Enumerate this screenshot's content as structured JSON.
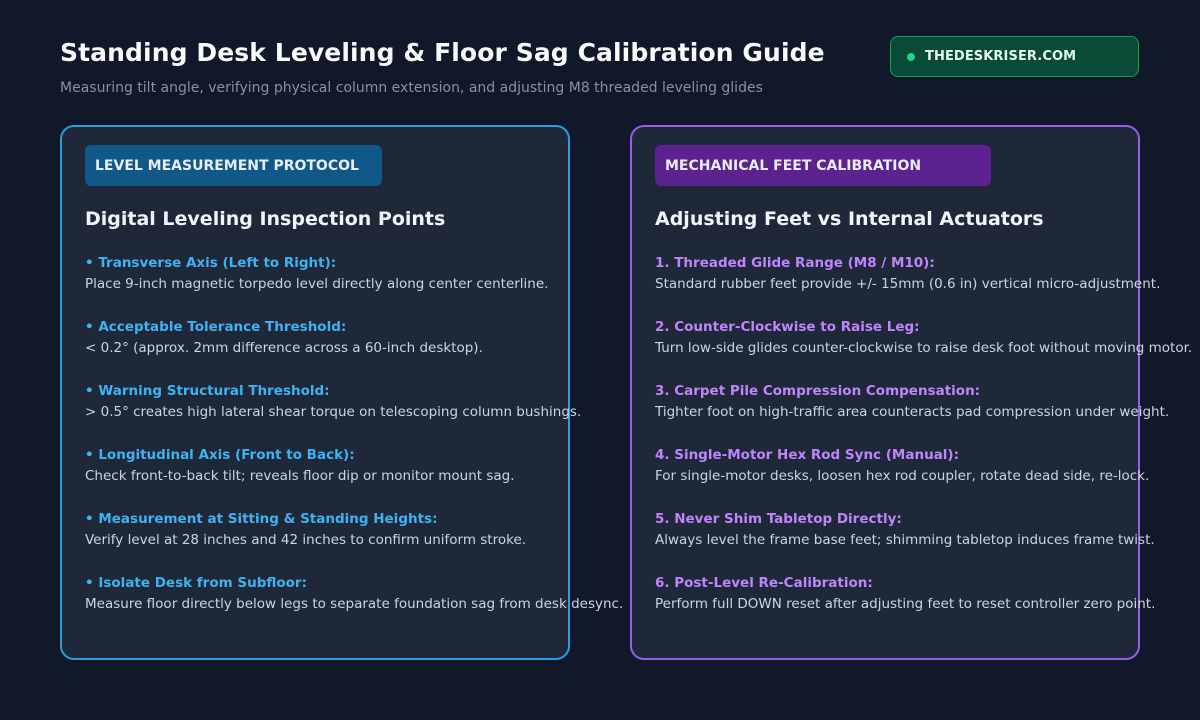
{
  "header": {
    "title": "Standing Desk Leveling & Floor Sag Calibration Guide",
    "subtitle": "Measuring tilt angle, verifying physical column extension, and adjusting M8 threaded leveling glides"
  },
  "brand": {
    "label": "THEDESKRISER.COM"
  },
  "left_card": {
    "tag": "LEVEL MEASUREMENT PROTOCOL",
    "title": "Digital Leveling Inspection Points",
    "items": [
      {
        "head": "• Transverse Axis (Left to Right):",
        "body": "Place 9-inch magnetic torpedo level directly along center centerline."
      },
      {
        "head": "• Acceptable Tolerance Threshold:",
        "body": "< 0.2° (approx. 2mm difference across a 60-inch desktop)."
      },
      {
        "head": "• Warning Structural Threshold:",
        "body": "> 0.5° creates high lateral shear torque on telescoping column bushings."
      },
      {
        "head": "• Longitudinal Axis (Front to Back):",
        "body": "Check front-to-back tilt; reveals floor dip or monitor mount sag."
      },
      {
        "head": "• Measurement at Sitting & Standing Heights:",
        "body": "Verify level at 28 inches and 42 inches to confirm uniform stroke."
      },
      {
        "head": "• Isolate Desk from Subfloor:",
        "body": "Measure floor directly below legs to separate foundation sag from desk desync."
      }
    ]
  },
  "right_card": {
    "tag": "MECHANICAL FEET CALIBRATION",
    "title": "Adjusting Feet vs Internal Actuators",
    "items": [
      {
        "head": "1. Threaded Glide Range (M8 / M10):",
        "body": "Standard rubber feet provide +/- 15mm (0.6 in) vertical micro-adjustment."
      },
      {
        "head": "2. Counter-Clockwise to Raise Leg:",
        "body": "Turn low-side glides counter-clockwise to raise desk foot without moving motor."
      },
      {
        "head": "3. Carpet Pile Compression Compensation:",
        "body": "Tighter foot on high-traffic area counteracts pad compression under weight."
      },
      {
        "head": "4. Single-Motor Hex Rod Sync (Manual):",
        "body": "For single-motor desks, loosen hex rod coupler, rotate dead side, re-lock."
      },
      {
        "head": "5. Never Shim Tabletop Directly:",
        "body": "Always level the frame base feet; shimming tabletop induces frame twist."
      },
      {
        "head": "6. Post-Level Re-Calibration:",
        "body": "Perform full DOWN reset after adjusting feet to reset controller zero point."
      }
    ]
  }
}
